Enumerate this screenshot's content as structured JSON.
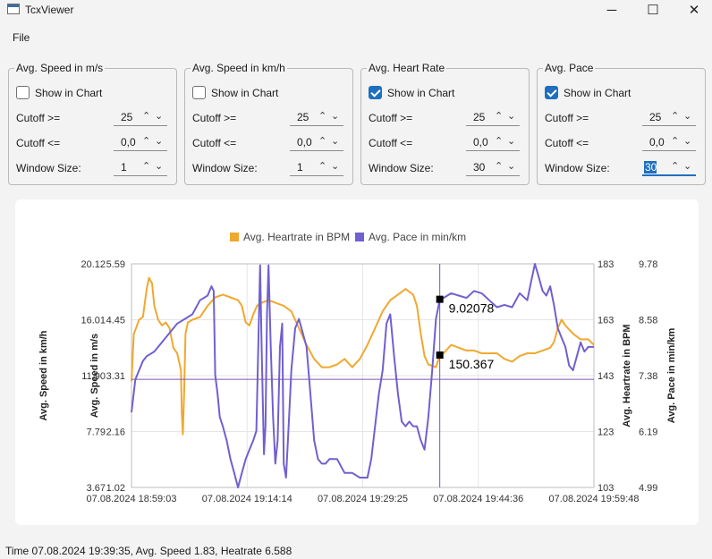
{
  "window": {
    "title": "TcxViewer",
    "minimize_glyph": "─",
    "maximize_glyph": "☐",
    "close_glyph": "✕"
  },
  "menu": {
    "file": "File"
  },
  "groups": [
    {
      "title": "Avg. Speed in m/s",
      "show_label": "Show in Chart",
      "checked": false,
      "cutoff_ge_label": "Cutoff >=",
      "cutoff_ge": "25",
      "cutoff_le_label": "Cutoff <=",
      "cutoff_le": "0,0",
      "window_label": "Window Size:",
      "window": "1"
    },
    {
      "title": "Avg. Speed in km/h",
      "show_label": "Show in Chart",
      "checked": false,
      "cutoff_ge_label": "Cutoff >=",
      "cutoff_ge": "25",
      "cutoff_le_label": "Cutoff <=",
      "cutoff_le": "0,0",
      "window_label": "Window Size:",
      "window": "1"
    },
    {
      "title": "Avg. Heart Rate",
      "show_label": "Show in Chart",
      "checked": true,
      "cutoff_ge_label": "Cutoff >=",
      "cutoff_ge": "25",
      "cutoff_le_label": "Cutoff <=",
      "cutoff_le": "0,0",
      "window_label": "Window Size:",
      "window": "30"
    },
    {
      "title": "Avg. Pace",
      "show_label": "Show in Chart",
      "checked": true,
      "cutoff_ge_label": "Cutoff >=",
      "cutoff_ge": "25",
      "cutoff_le_label": "Cutoff <=",
      "cutoff_le": "0,0",
      "window_label": "Window Size:",
      "window": "30"
    }
  ],
  "spin_glyphs": {
    "up": "⌃",
    "down": "⌄"
  },
  "chart_data": {
    "type": "line",
    "legend": [
      {
        "name": "Avg. Heartrate in BPM",
        "color": "#f0a830"
      },
      {
        "name": "Avg. Pace in min/km",
        "color": "#7060d0"
      }
    ],
    "legend_position": "top",
    "grid": true,
    "x_ticks": [
      "07.08.2024 18:59:03",
      "07.08.2024 19:14:14",
      "07.08.2024 19:29:25",
      "07.08.2024 19:44:36",
      "07.08.2024 19:59:48"
    ],
    "axes": {
      "speed_kmh": {
        "label": "Avg. Speed in km/h",
        "ticks": [
          "20.12",
          "16.01",
          "11.90",
          "7.79",
          "3.67"
        ],
        "range": [
          3.67,
          20.12
        ]
      },
      "speed_ms": {
        "label": "Avg. Speed in m/s",
        "ticks": [
          "5.59",
          "4.45",
          "3.31",
          "2.16",
          "1.02"
        ],
        "range": [
          1.02,
          5.59
        ]
      },
      "heartrate": {
        "label": "Avg. Heartrate in BPM",
        "ticks": [
          "183",
          "163",
          "143",
          "123",
          "103"
        ],
        "range": [
          103,
          183
        ]
      },
      "pace": {
        "label": "Avg. Pace in min/km",
        "ticks": [
          "9.78",
          "8.58",
          "7.38",
          "6.19",
          "4.99"
        ],
        "range": [
          4.99,
          9.78
        ]
      }
    },
    "x_range_minutes": [
      0,
      60.75
    ],
    "crosshair": {
      "time_minutes": 40.5,
      "hline_heartrate": 141.7
    },
    "markers": [
      {
        "label": "9.02078",
        "series": "pace",
        "value": 9.02078
      },
      {
        "label": "150.367",
        "series": "heartrate",
        "value": 150.367
      }
    ],
    "series": [
      {
        "name": "Avg. Heartrate in BPM",
        "axis": "heartrate",
        "color": "#f0a830",
        "points": [
          [
            0,
            141
          ],
          [
            0.3,
            158
          ],
          [
            0.6,
            160
          ],
          [
            1,
            163
          ],
          [
            1.5,
            164
          ],
          [
            2,
            174
          ],
          [
            2.3,
            178
          ],
          [
            2.7,
            176
          ],
          [
            3,
            168
          ],
          [
            3.5,
            163
          ],
          [
            4,
            161
          ],
          [
            4.5,
            162
          ],
          [
            5,
            160
          ],
          [
            5.5,
            153
          ],
          [
            6,
            151
          ],
          [
            6.5,
            145
          ],
          [
            6.6,
            130
          ],
          [
            6.75,
            122
          ],
          [
            6.9,
            135
          ],
          [
            7.1,
            158
          ],
          [
            7.4,
            162
          ],
          [
            8,
            163
          ],
          [
            9,
            164
          ],
          [
            10,
            168
          ],
          [
            11,
            171
          ],
          [
            12,
            172
          ],
          [
            13,
            171
          ],
          [
            14,
            170
          ],
          [
            14.5,
            168
          ],
          [
            15,
            162
          ],
          [
            15.5,
            161
          ],
          [
            16,
            165
          ],
          [
            16.5,
            168
          ],
          [
            17,
            169
          ],
          [
            18,
            170
          ],
          [
            19,
            169
          ],
          [
            20,
            168
          ],
          [
            21,
            166
          ],
          [
            22,
            160
          ],
          [
            23,
            154
          ],
          [
            24,
            149
          ],
          [
            25,
            146
          ],
          [
            26,
            146
          ],
          [
            27,
            147
          ],
          [
            28,
            149
          ],
          [
            29,
            146
          ],
          [
            30,
            149
          ],
          [
            31,
            154
          ],
          [
            32,
            160
          ],
          [
            33,
            166
          ],
          [
            34,
            170
          ],
          [
            35,
            172
          ],
          [
            36,
            174
          ],
          [
            37,
            172
          ],
          [
            37.5,
            168
          ],
          [
            38,
            158
          ],
          [
            38.5,
            150
          ],
          [
            39,
            147
          ],
          [
            40,
            146
          ],
          [
            40.5,
            150.4
          ],
          [
            41,
            151
          ],
          [
            42,
            154
          ],
          [
            43,
            153
          ],
          [
            44,
            152
          ],
          [
            45,
            152
          ],
          [
            46,
            151
          ],
          [
            47,
            151
          ],
          [
            48,
            151
          ],
          [
            49,
            149
          ],
          [
            50,
            148
          ],
          [
            51,
            150
          ],
          [
            52,
            151
          ],
          [
            53,
            151
          ],
          [
            54,
            152
          ],
          [
            55,
            153
          ],
          [
            55.5,
            155
          ],
          [
            56,
            160
          ],
          [
            56.5,
            163
          ],
          [
            57,
            161
          ],
          [
            58,
            158
          ],
          [
            59,
            156
          ],
          [
            60,
            156
          ],
          [
            60.75,
            154
          ]
        ]
      },
      {
        "name": "Avg. Pace in min/km",
        "axis": "pace",
        "color": "#7060d0",
        "points": [
          [
            0,
            6.6
          ],
          [
            0.5,
            7.3
          ],
          [
            1,
            7.5
          ],
          [
            1.5,
            7.7
          ],
          [
            2,
            7.8
          ],
          [
            3,
            7.9
          ],
          [
            4,
            8.1
          ],
          [
            5,
            8.3
          ],
          [
            6,
            8.5
          ],
          [
            7,
            8.6
          ],
          [
            8,
            8.7
          ],
          [
            9,
            9.0
          ],
          [
            10,
            9.1
          ],
          [
            10.5,
            9.3
          ],
          [
            10.8,
            9.2
          ],
          [
            11,
            7.4
          ],
          [
            11.3,
            7.0
          ],
          [
            11.6,
            6.5
          ],
          [
            12,
            6.3
          ],
          [
            12.5,
            6.0
          ],
          [
            13,
            5.6
          ],
          [
            13.5,
            5.3
          ],
          [
            14,
            4.99
          ],
          [
            14.5,
            5.3
          ],
          [
            15,
            5.6
          ],
          [
            15.5,
            5.8
          ],
          [
            16,
            6.0
          ],
          [
            16.4,
            6.2
          ],
          [
            16.7,
            8.3
          ],
          [
            16.9,
            9.75
          ],
          [
            17.1,
            8.0
          ],
          [
            17.4,
            5.7
          ],
          [
            17.6,
            6.3
          ],
          [
            17.8,
            8.7
          ],
          [
            18,
            9.75
          ],
          [
            18.3,
            8.0
          ],
          [
            18.6,
            6.5
          ],
          [
            18.9,
            5.5
          ],
          [
            19.2,
            6.0
          ],
          [
            19.5,
            8.0
          ],
          [
            19.8,
            8.5
          ],
          [
            20,
            5.5
          ],
          [
            20.3,
            5.2
          ],
          [
            20.7,
            6.5
          ],
          [
            21,
            7.5
          ],
          [
            21.5,
            8.4
          ],
          [
            22,
            8.6
          ],
          [
            22.5,
            8.3
          ],
          [
            23,
            8.0
          ],
          [
            23.5,
            7.0
          ],
          [
            24,
            6.0
          ],
          [
            24.5,
            5.6
          ],
          [
            25,
            5.5
          ],
          [
            25.5,
            5.5
          ],
          [
            26,
            5.6
          ],
          [
            27,
            5.6
          ],
          [
            28,
            5.3
          ],
          [
            29,
            5.3
          ],
          [
            30,
            5.2
          ],
          [
            31,
            5.2
          ],
          [
            31.5,
            5.6
          ],
          [
            32,
            6.3
          ],
          [
            32.5,
            7.0
          ],
          [
            33,
            7.5
          ],
          [
            33.5,
            8.5
          ],
          [
            34,
            8.7
          ],
          [
            34.5,
            7.8
          ],
          [
            35,
            7.0
          ],
          [
            35.5,
            6.4
          ],
          [
            36,
            6.3
          ],
          [
            36.5,
            6.4
          ],
          [
            37,
            6.3
          ],
          [
            37.5,
            6.3
          ],
          [
            38,
            6.0
          ],
          [
            38.5,
            5.8
          ],
          [
            39,
            6.5
          ],
          [
            39.5,
            7.5
          ],
          [
            40,
            8.6
          ],
          [
            40.5,
            9.02
          ],
          [
            41,
            9.05
          ],
          [
            42,
            9.15
          ],
          [
            43,
            9.1
          ],
          [
            44,
            9.05
          ],
          [
            45,
            9.2
          ],
          [
            46,
            9.15
          ],
          [
            47,
            9.0
          ],
          [
            48,
            8.85
          ],
          [
            49,
            8.9
          ],
          [
            50,
            8.85
          ],
          [
            51,
            9.15
          ],
          [
            52,
            9.0
          ],
          [
            52.5,
            9.4
          ],
          [
            53,
            9.78
          ],
          [
            53.5,
            9.5
          ],
          [
            54,
            9.2
          ],
          [
            54.5,
            9.1
          ],
          [
            55,
            9.3
          ],
          [
            55.5,
            8.9
          ],
          [
            56,
            8.4
          ],
          [
            56.5,
            8.2
          ],
          [
            57,
            8.0
          ],
          [
            57.5,
            7.6
          ],
          [
            58,
            7.5
          ],
          [
            58.5,
            7.8
          ],
          [
            59,
            8.1
          ],
          [
            59.5,
            7.9
          ],
          [
            60,
            8.0
          ],
          [
            60.75,
            8.0
          ]
        ]
      }
    ]
  },
  "status": "Time 07.08.2024 19:39:35, Avg. Speed 1.83, Heatrate 6.588"
}
